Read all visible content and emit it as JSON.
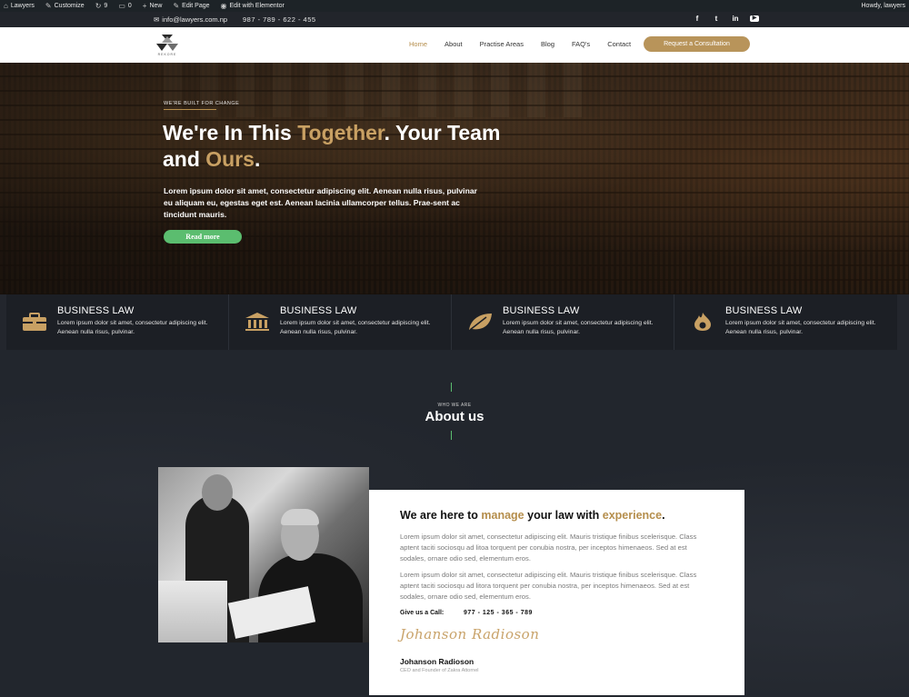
{
  "adminbar": {
    "site": "Lawyers",
    "customize": "Customize",
    "updates": "9",
    "comments": "0",
    "new": "New",
    "edit_page": "Edit Page",
    "elementor": "Edit with Elementor",
    "howdy": "Howdy, lawyers"
  },
  "topbar": {
    "email": "info@lawyers.com.np",
    "phone": "987 - 789 - 622 - 455",
    "social": [
      "f",
      "t",
      "in",
      "yt"
    ]
  },
  "nav": {
    "logo_text": "REKORE",
    "items": [
      "Home",
      "About",
      "Practise Areas",
      "Blog",
      "FAQ's",
      "Contact"
    ],
    "active": "Home",
    "cta": "Request a Consultation"
  },
  "hero": {
    "eyebrow": "WE'RE BUILT FOR CHANGE",
    "title_part1": "We're In This ",
    "title_gold1": "Together",
    "title_part2": ". Your Team and ",
    "title_gold2": "Ours",
    "title_part3": ".",
    "lead": "Lorem ipsum dolor sit amet, consectetur adipiscing elit. Aenean nulla risus, pulvinar eu aliquam eu, egestas eget est. Aenean lacinia ullamcorper tellus. Prae-sent ac tincidunt mauris.",
    "button": "Read more"
  },
  "services": [
    {
      "icon": "briefcase-icon",
      "title": "BUSINESS LAW",
      "text": "Lorem ipsum dolor sit amet, consectetur adipiscing elit. Aenean nulla risus, pulvinar."
    },
    {
      "icon": "courthouse-icon",
      "title": "BUSINESS LAW",
      "text": "Lorem ipsum dolor sit amet, consectetur adipiscing elit. Aenean nulla risus, pulvinar."
    },
    {
      "icon": "leaf-icon",
      "title": "BUSINESS LAW",
      "text": "Lorem ipsum dolor sit amet, consectetur adipiscing elit. Aenean nulla risus, pulvinar."
    },
    {
      "icon": "flame-icon",
      "title": "BUSINESS LAW",
      "text": "Lorem ipsum dolor sit amet, consectetur adipiscing elit. Aenean nulla risus, pulvinar."
    }
  ],
  "about": {
    "eyebrow": "WHO WE ARE",
    "title": "About us",
    "heading_part1": "We are here to ",
    "heading_gold1": "manage",
    "heading_part2": " your law with ",
    "heading_gold2": "experience",
    "heading_part3": ".",
    "para1": "Lorem ipsum dolor sit amet, consectetur adipiscing elit. Mauris tristique finibus scelerisque. Class aptent taciti sociosqu ad litoa torquent per conubia nostra, per inceptos himenaeos. Sed at est sodales, ornare odio sed, elementum eros.",
    "para2": "Lorem ipsum dolor sit amet, consectetur adipiscing elit. Mauris tristique finibus scelerisque. Class aptent taciti sociosqu ad litora torquent per conubia nostra, per inceptos himenaeos. Sed at est sodales, ornare odio sed, elementum eros.",
    "call_label": "Give us a Call:",
    "call_number": "977 - 125 - 365 - 789",
    "signature": "Johanson Radioson",
    "name": "Johanson Radioson",
    "role": "CEO and Founder of Zakra Attornel"
  },
  "colors": {
    "gold": "#b58e4c",
    "green": "#5bbd6f",
    "dark": "#22262d"
  }
}
